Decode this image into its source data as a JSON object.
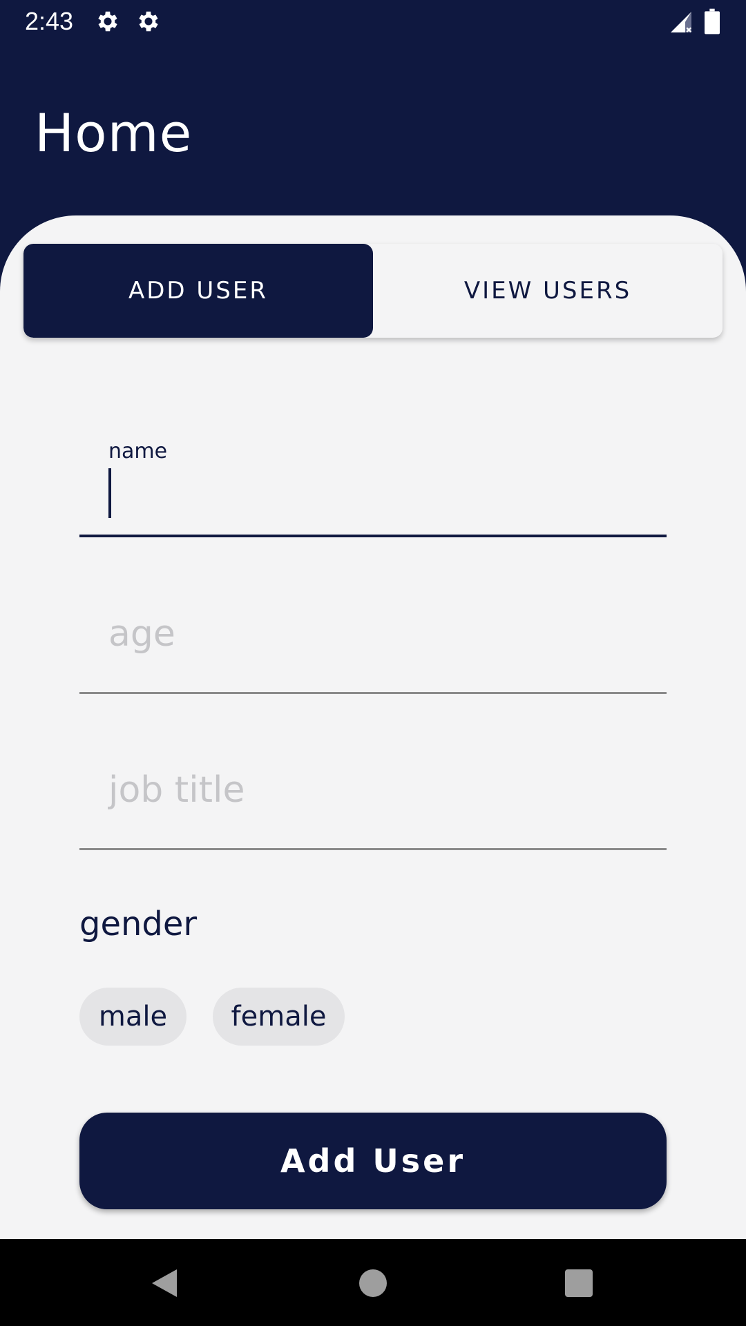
{
  "status_bar": {
    "time": "2:43",
    "icons": [
      "gear-icon",
      "gear-icon",
      "signal-icon",
      "battery-icon"
    ]
  },
  "app_bar": {
    "title": "Home"
  },
  "tabs": [
    {
      "label": "ADD USER",
      "active": true
    },
    {
      "label": "VIEW USERS",
      "active": false
    }
  ],
  "form": {
    "name": {
      "label": "name",
      "value": ""
    },
    "age": {
      "placeholder": "age",
      "value": ""
    },
    "job_title": {
      "placeholder": "job title",
      "value": ""
    },
    "gender": {
      "label": "gender",
      "options": [
        "male",
        "female"
      ]
    },
    "submit_label": "Add User"
  },
  "colors": {
    "primary": "#0f1840",
    "surface": "#f4f4f5",
    "chip": "#e4e4e6",
    "placeholder": "#c5c5c8"
  },
  "nav_bar": {
    "icons": [
      "back-icon",
      "home-icon",
      "recents-icon"
    ]
  }
}
